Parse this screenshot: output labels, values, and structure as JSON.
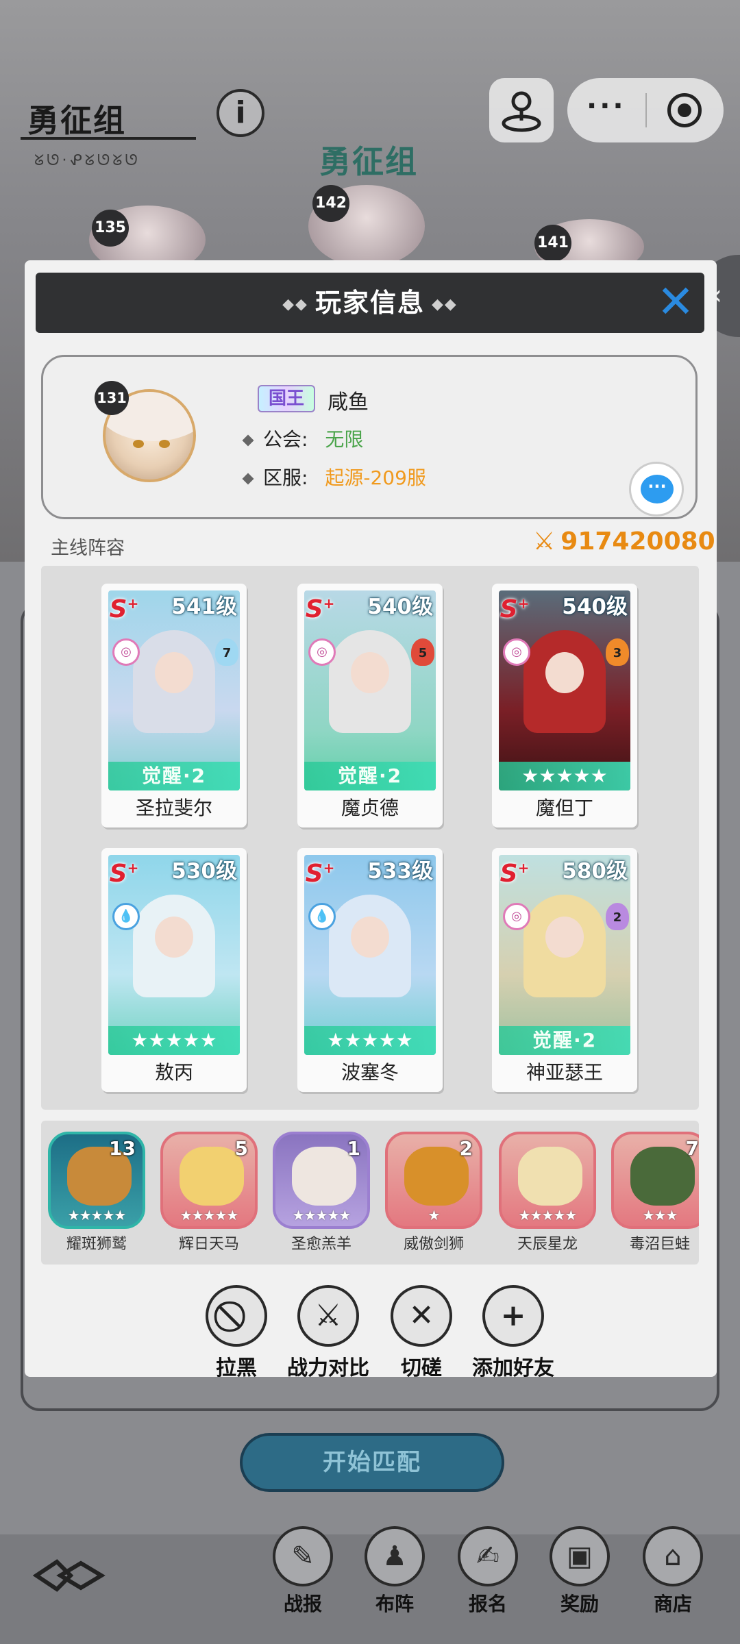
{
  "background": {
    "team_title": "勇征组",
    "team_subtitle": "ᘜᘎ·ᕵᘜᘎᘜᘎ",
    "team_banner": "勇征组",
    "opponent_levels": [
      "135",
      "142",
      "141"
    ],
    "start_button": "开始匹配",
    "nav": [
      {
        "label": "战报",
        "icon": "report-icon"
      },
      {
        "label": "布阵",
        "icon": "formation-icon"
      },
      {
        "label": "报名",
        "icon": "signup-icon"
      },
      {
        "label": "奖励",
        "icon": "reward-icon"
      },
      {
        "label": "商店",
        "icon": "shop-icon"
      }
    ]
  },
  "modal": {
    "title": "玩家信息",
    "profile": {
      "level": "131",
      "vip_badge": "国王",
      "name": "咸鱼",
      "guild_label": "公会:",
      "guild_value": "无限",
      "server_label": "区服:",
      "server_value": "起源-209服"
    },
    "lineup_label": "主线阵容",
    "power": "917420080",
    "heroes": [
      {
        "name": "圣拉斐尔",
        "level": "541级",
        "rank": "S",
        "class_num": "7",
        "element": "arcane",
        "badge": "觉醒·2",
        "stars": 0
      },
      {
        "name": "魔贞德",
        "level": "540级",
        "rank": "S",
        "class_num": "5",
        "element": "arcane",
        "badge": "觉醒·2",
        "stars": 0
      },
      {
        "name": "魔但丁",
        "level": "540级",
        "rank": "S",
        "class_num": "3",
        "element": "arcane",
        "badge": "",
        "stars": 5
      },
      {
        "name": "敖丙",
        "level": "530级",
        "rank": "S",
        "class_num": "",
        "element": "water",
        "badge": "",
        "stars": 5
      },
      {
        "name": "波塞冬",
        "level": "533级",
        "rank": "S",
        "class_num": "",
        "element": "water",
        "badge": "",
        "stars": 5
      },
      {
        "name": "神亚瑟王",
        "level": "580级",
        "rank": "S",
        "class_num": "2",
        "element": "arcane",
        "badge": "觉醒·2",
        "stars": 0
      }
    ],
    "pets": [
      {
        "name": "耀斑狮鹫",
        "count": "13",
        "stars": 5,
        "frame": "#2fb5a8"
      },
      {
        "name": "辉日天马",
        "count": "5",
        "stars": 5,
        "frame": "#e0707a"
      },
      {
        "name": "圣愈羔羊",
        "count": "1",
        "stars": 5,
        "frame": "#9b7fd0"
      },
      {
        "name": "威傲剑狮",
        "count": "2",
        "stars": 1,
        "frame": "#e0707a"
      },
      {
        "name": "天辰星龙",
        "count": "",
        "stars": 5,
        "frame": "#e0707a"
      },
      {
        "name": "毒沼巨蛙",
        "count": "7",
        "stars": 3,
        "frame": "#e0707a"
      }
    ],
    "actions": [
      {
        "label": "拉黑",
        "icon": "block-icon"
      },
      {
        "label": "战力对比",
        "icon": "compare-power-icon"
      },
      {
        "label": "切磋",
        "icon": "duel-icon"
      },
      {
        "label": "添加好友",
        "icon": "add-friend-icon"
      }
    ]
  },
  "colors": {
    "accent_blue": "#2a8ae0",
    "power_orange": "#e88a12",
    "guild_green": "#4aa44a",
    "server_orange": "#f09a1e"
  }
}
